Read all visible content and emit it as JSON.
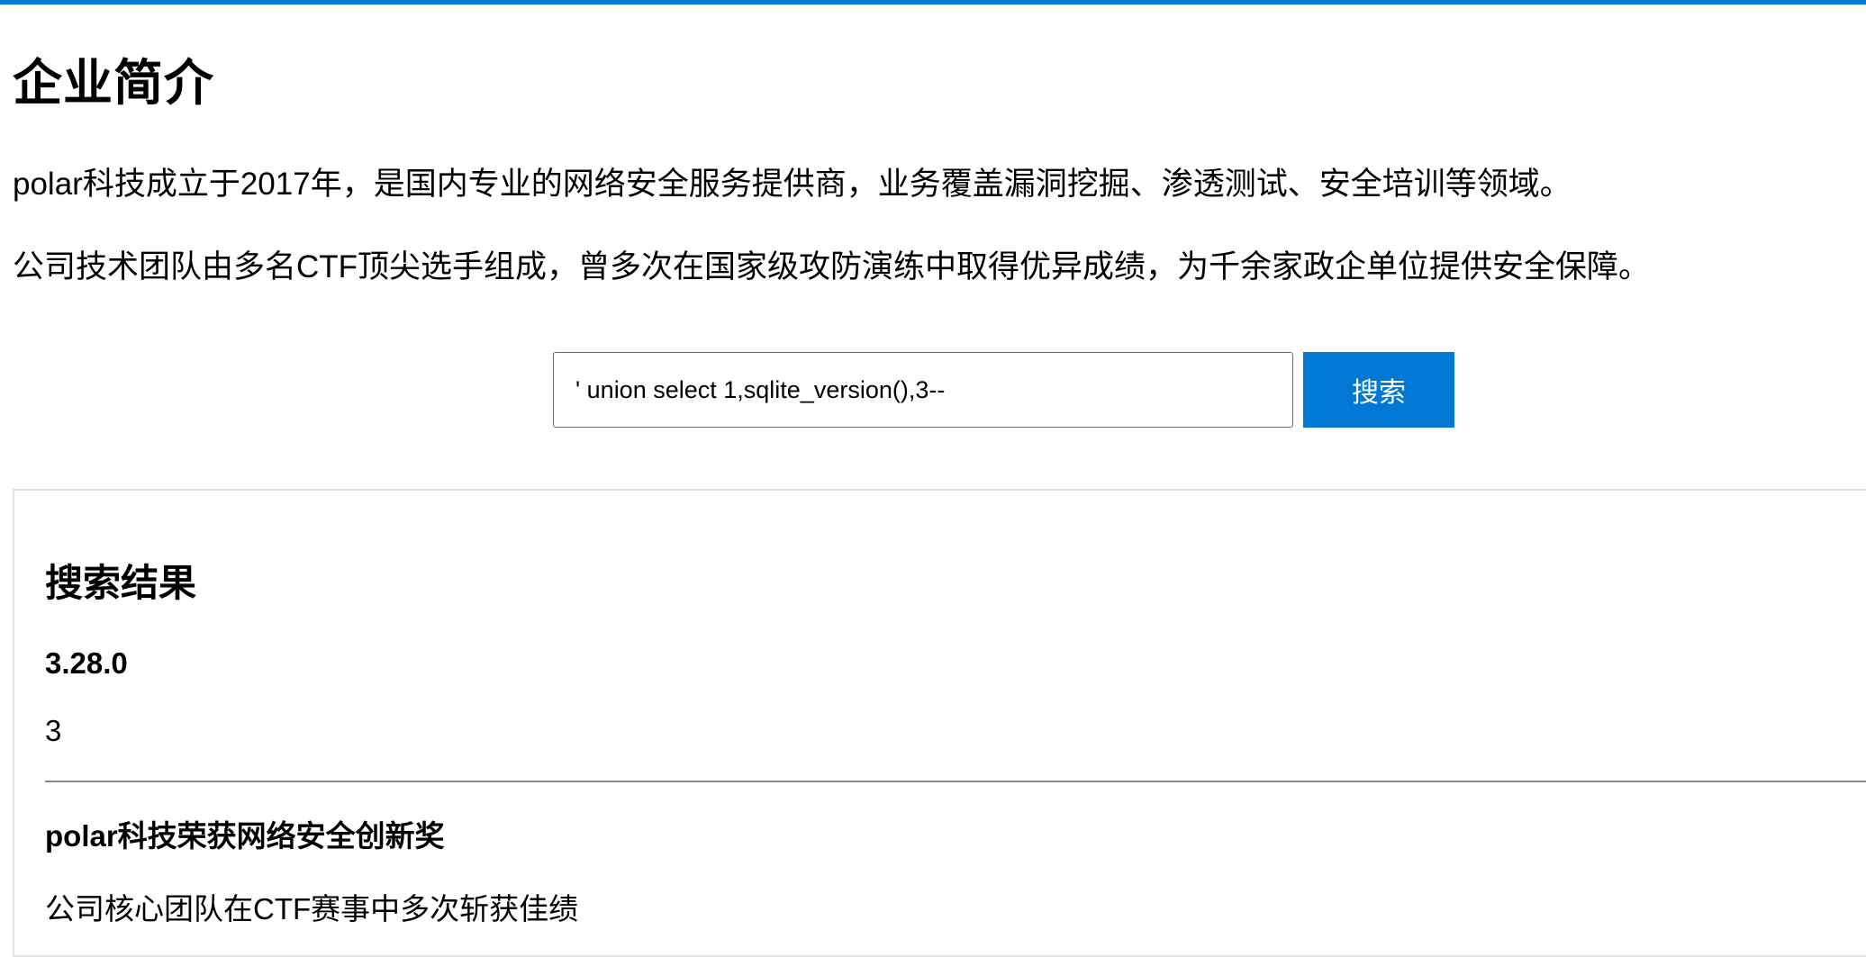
{
  "theme": {
    "accent": "#0078d4",
    "border": "#e2e2e2",
    "divider": "#8a8a8a"
  },
  "page": {
    "title": "企业简介",
    "intro": [
      "polar科技成立于2017年，是国内专业的网络安全服务提供商，业务覆盖漏洞挖掘、渗透测试、安全培训等领域。",
      "公司技术团队由多名CTF顶尖选手组成，曾多次在国家级攻防演练中取得优异成绩，为千余家政企单位提供安全保障。"
    ]
  },
  "search": {
    "value": "' union select 1,sqlite_version(),3--",
    "button_label": "搜索"
  },
  "results": {
    "heading": "搜索结果",
    "items": [
      {
        "title": "3.28.0",
        "body": "3"
      },
      {
        "title": "polar科技荣获网络安全创新奖",
        "body": "公司核心团队在CTF赛事中多次斩获佳绩"
      }
    ]
  }
}
